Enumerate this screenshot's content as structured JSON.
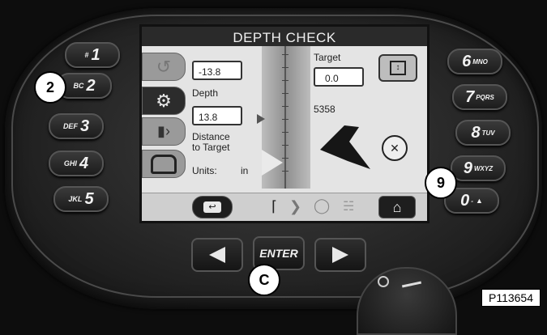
{
  "screen": {
    "title": "DEPTH CHECK",
    "depth_value": "-13.8",
    "depth_label": "Depth",
    "distance_value": "13.8",
    "distance_label_line1": "Distance",
    "distance_label_line2": "to Target",
    "units_label": "Units:",
    "units_value": "in",
    "target_label": "Target",
    "target_value": "0.0",
    "signal_value": "5358"
  },
  "keypad_left": [
    {
      "small": "#",
      "big": "1"
    },
    {
      "small": "BC",
      "big": "2"
    },
    {
      "small": "DEF",
      "big": "3"
    },
    {
      "small": "GHI",
      "big": "4"
    },
    {
      "small": "JKL",
      "big": "5"
    }
  ],
  "keypad_right": [
    {
      "big": "6",
      "small": "MNO"
    },
    {
      "big": "7",
      "small": "PQRS"
    },
    {
      "big": "8",
      "small": "TUV"
    },
    {
      "big": "9",
      "small": "WXYZ"
    },
    {
      "big": "0",
      "small": "-"
    }
  ],
  "nav": {
    "enter_label": "ENTER"
  },
  "callouts": {
    "two": "2",
    "nine": "9",
    "c": "C"
  },
  "figure_label": "P113654"
}
